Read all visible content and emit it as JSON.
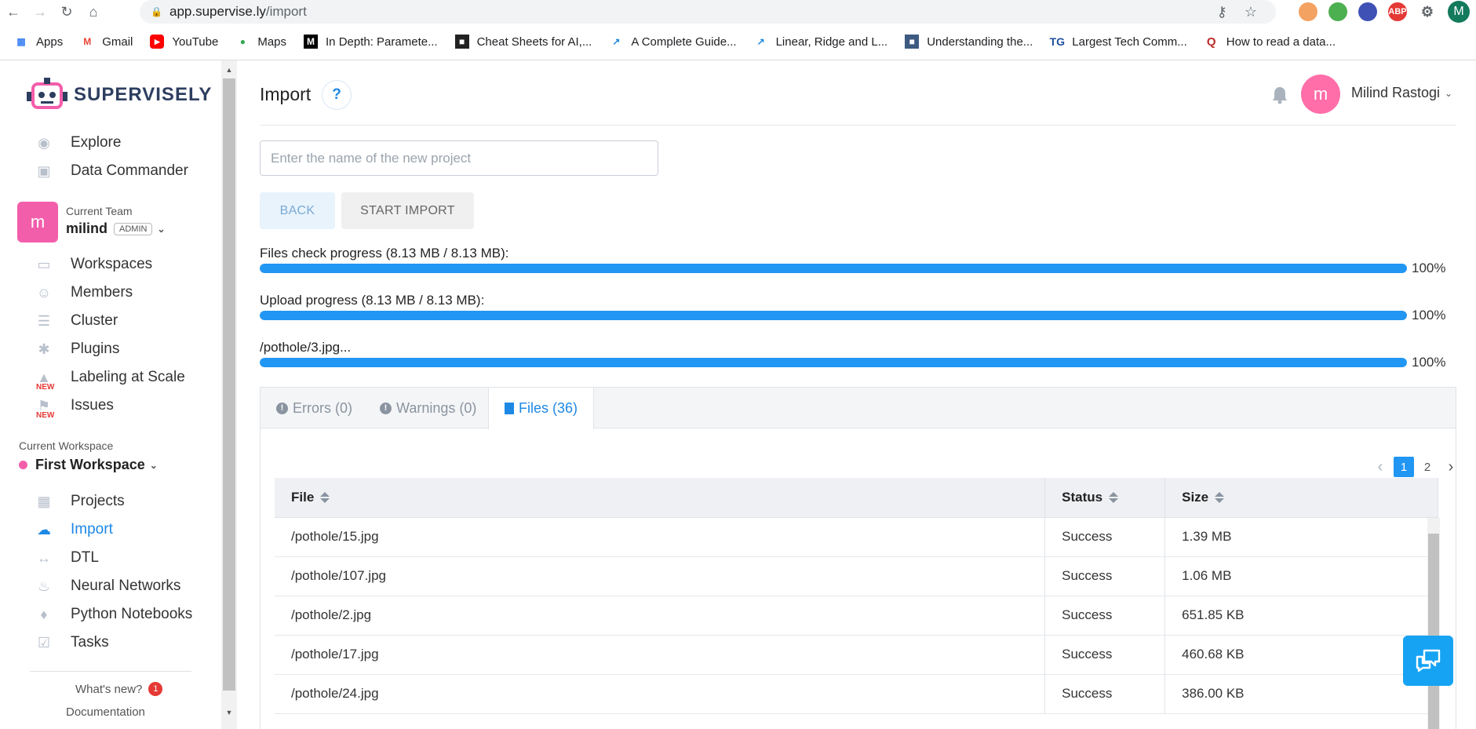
{
  "browser": {
    "url_host": "app.supervise.ly",
    "url_path": "/import",
    "profile_initial": "M",
    "bookmarks": [
      {
        "label": "Apps"
      },
      {
        "label": "Gmail"
      },
      {
        "label": "YouTube"
      },
      {
        "label": "Maps"
      },
      {
        "label": "In Depth: Paramete..."
      },
      {
        "label": "Cheat Sheets for AI,..."
      },
      {
        "label": "A Complete Guide..."
      },
      {
        "label": "Linear, Ridge and L..."
      },
      {
        "label": "Understanding the..."
      },
      {
        "label": "Largest Tech Comm..."
      },
      {
        "label": "How to read a data..."
      }
    ],
    "ext_abp": "ABP"
  },
  "sidebar": {
    "logo_text": "SUPERVISELY",
    "items_top": [
      {
        "label": "Explore"
      },
      {
        "label": "Data Commander"
      }
    ],
    "team": {
      "label": "Current Team",
      "initial": "m",
      "name": "milind",
      "role": "ADMIN"
    },
    "items_team": [
      {
        "label": "Workspaces"
      },
      {
        "label": "Members"
      },
      {
        "label": "Cluster"
      },
      {
        "label": "Plugins"
      },
      {
        "label": "Labeling at Scale",
        "badge": "NEW"
      },
      {
        "label": "Issues",
        "badge": "NEW"
      }
    ],
    "workspace": {
      "label": "Current Workspace",
      "name": "First Workspace"
    },
    "items_ws": [
      {
        "label": "Projects"
      },
      {
        "label": "Import"
      },
      {
        "label": "DTL"
      },
      {
        "label": "Neural Networks"
      },
      {
        "label": "Python Notebooks"
      },
      {
        "label": "Tasks"
      }
    ],
    "whats_new": "What's new?",
    "whats_new_count": "1",
    "documentation": "Documentation"
  },
  "header": {
    "title": "Import",
    "help": "?",
    "user_initial": "m",
    "user_name": "Milind Rastogi"
  },
  "form": {
    "project_placeholder": "Enter the name of the new project",
    "project_value": "",
    "back_label": "BACK",
    "start_label": "START IMPORT"
  },
  "progress": [
    {
      "label": "Files check progress (8.13 MB / 8.13 MB):",
      "percent": 100,
      "percent_text": "100%"
    },
    {
      "label": "Upload progress (8.13 MB / 8.13 MB):",
      "percent": 100,
      "percent_text": "100%"
    },
    {
      "label": "/pothole/3.jpg...",
      "percent": 100,
      "percent_text": "100%"
    }
  ],
  "tabs": [
    {
      "label": "Errors (0)"
    },
    {
      "label": "Warnings (0)"
    },
    {
      "label": "Files (36)"
    }
  ],
  "pager": {
    "pages": [
      "1",
      "2"
    ],
    "current": "1"
  },
  "table": {
    "headers": [
      "File",
      "Status",
      "Size"
    ],
    "rows": [
      [
        "/pothole/15.jpg",
        "Success",
        "1.39 MB"
      ],
      [
        "/pothole/107.jpg",
        "Success",
        "1.06 MB"
      ],
      [
        "/pothole/2.jpg",
        "Success",
        "651.85 KB"
      ],
      [
        "/pothole/17.jpg",
        "Success",
        "460.68 KB"
      ],
      [
        "/pothole/24.jpg",
        "Success",
        "386.00 KB"
      ]
    ]
  },
  "colors": {
    "accent": "#1e88e5",
    "progress": "#2196f3",
    "brand_pink": "#f35eab"
  }
}
